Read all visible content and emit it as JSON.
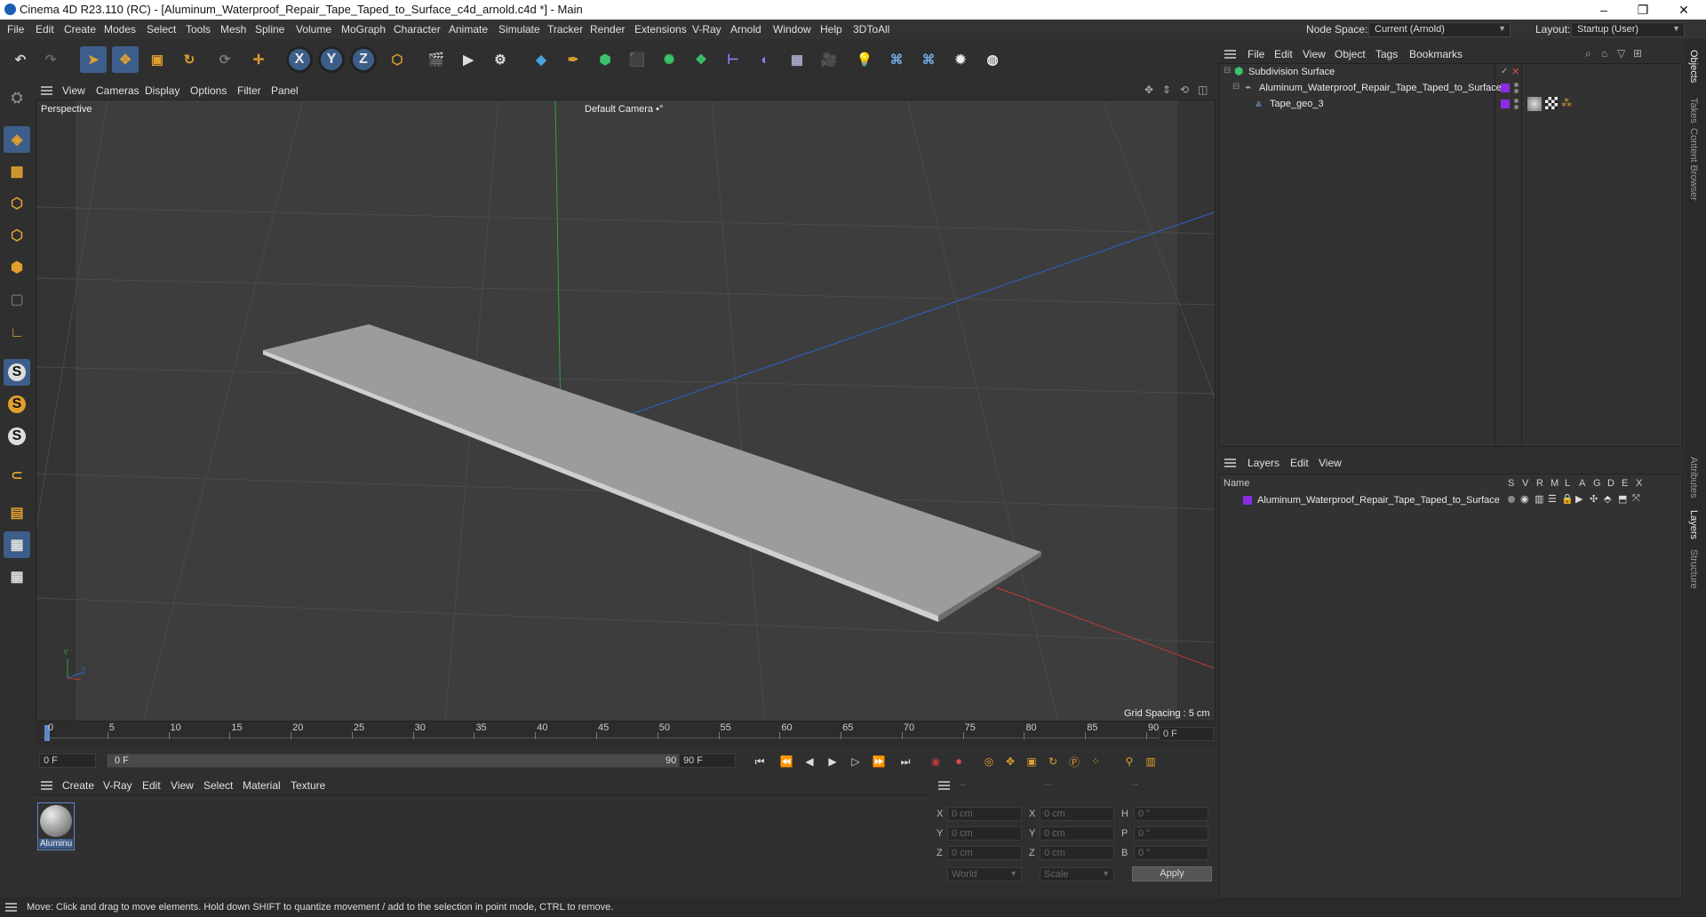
{
  "window": {
    "title": "Cinema 4D R23.110 (RC) - [Aluminum_Waterproof_Repair_Tape_Taped_to_Surface_c4d_arnold.c4d *] - Main",
    "minimize": "–",
    "maximize": "❐",
    "close": "✕"
  },
  "menubar": {
    "items": [
      "File",
      "Edit",
      "Create",
      "Modes",
      "Select",
      "Tools",
      "Mesh",
      "Spline",
      "Volume",
      "MoGraph",
      "Character",
      "Animate",
      "Simulate",
      "Tracker",
      "Render",
      "Extensions",
      "V-Ray",
      "Arnold",
      "Window",
      "Help",
      "3DToAll"
    ],
    "node_space_label": "Node Space:",
    "node_space_value": "Current (Arnold)",
    "layout_label": "Layout:",
    "layout_value": "Startup (User)"
  },
  "toolbar": {
    "axis_x": "X",
    "axis_y": "Y",
    "axis_z": "Z"
  },
  "viewport": {
    "menu": [
      "View",
      "Cameras",
      "Display",
      "Options",
      "Filter",
      "Panel"
    ],
    "view_name": "Perspective",
    "camera": "Default Camera",
    "camera_suffix": "•°",
    "grid_spacing": "Grid Spacing : 5 cm",
    "axis_y": "Y",
    "axis_z": "Z"
  },
  "timeline": {
    "ticks": [
      "0",
      "5",
      "10",
      "15",
      "20",
      "25",
      "30",
      "35",
      "40",
      "45",
      "50",
      "55",
      "60",
      "65",
      "70",
      "75",
      "80",
      "85",
      "90"
    ],
    "current_frame_box": "0 F"
  },
  "playbar": {
    "start_field": "0 F",
    "range_start": "0 F",
    "range_end": "90 F",
    "end_field": "90 F"
  },
  "materials": {
    "menu": [
      "Create",
      "V-Ray",
      "Edit",
      "View",
      "Select",
      "Material",
      "Texture"
    ],
    "items": [
      {
        "name": "Aluminu"
      }
    ]
  },
  "coordinates": {
    "headers": [
      "--",
      "--",
      "--"
    ],
    "rows": [
      {
        "a_label": "X",
        "a_val": "0 cm",
        "b_label": "X",
        "b_val": "0 cm",
        "c_label": "H",
        "c_val": "0 °"
      },
      {
        "a_label": "Y",
        "a_val": "0 cm",
        "b_label": "Y",
        "b_val": "0 cm",
        "c_label": "P",
        "c_val": "0 °"
      },
      {
        "a_label": "Z",
        "a_val": "0 cm",
        "b_label": "Z",
        "b_val": "0 cm",
        "c_label": "B",
        "c_val": "0 °"
      }
    ],
    "mode1": "World",
    "mode2": "Scale",
    "apply": "Apply"
  },
  "objects": {
    "menu": [
      "File",
      "Edit",
      "View",
      "Object",
      "Tags",
      "Bookmarks"
    ],
    "tree": [
      {
        "name": "Subdivision Surface"
      },
      {
        "name": "Aluminum_Waterproof_Repair_Tape_Taped_to_Surface"
      },
      {
        "name": "Tape_geo_3"
      }
    ]
  },
  "layers": {
    "menu": [
      "Layers",
      "Edit",
      "View"
    ],
    "col_name": "Name",
    "cols": [
      "S",
      "V",
      "R",
      "M",
      "L",
      "A",
      "G",
      "D",
      "E",
      "X"
    ],
    "rows": [
      {
        "name": "Aluminum_Waterproof_Repair_Tape_Taped_to_Surface"
      }
    ]
  },
  "side_tabs": [
    "Objects",
    "Takes",
    "Content Browser",
    "Attributes",
    "Layers",
    "Structure"
  ],
  "status": "Move: Click and drag to move elements. Hold down SHIFT to quantize movement / add to the selection in point mode, CTRL to remove.",
  "colors": {
    "accent": "#3d5e8a",
    "layer_purple": "#8a2be2",
    "axis_green": "#2ea043",
    "axis_blue": "#2f62c9",
    "axis_red": "#c23b3b"
  }
}
